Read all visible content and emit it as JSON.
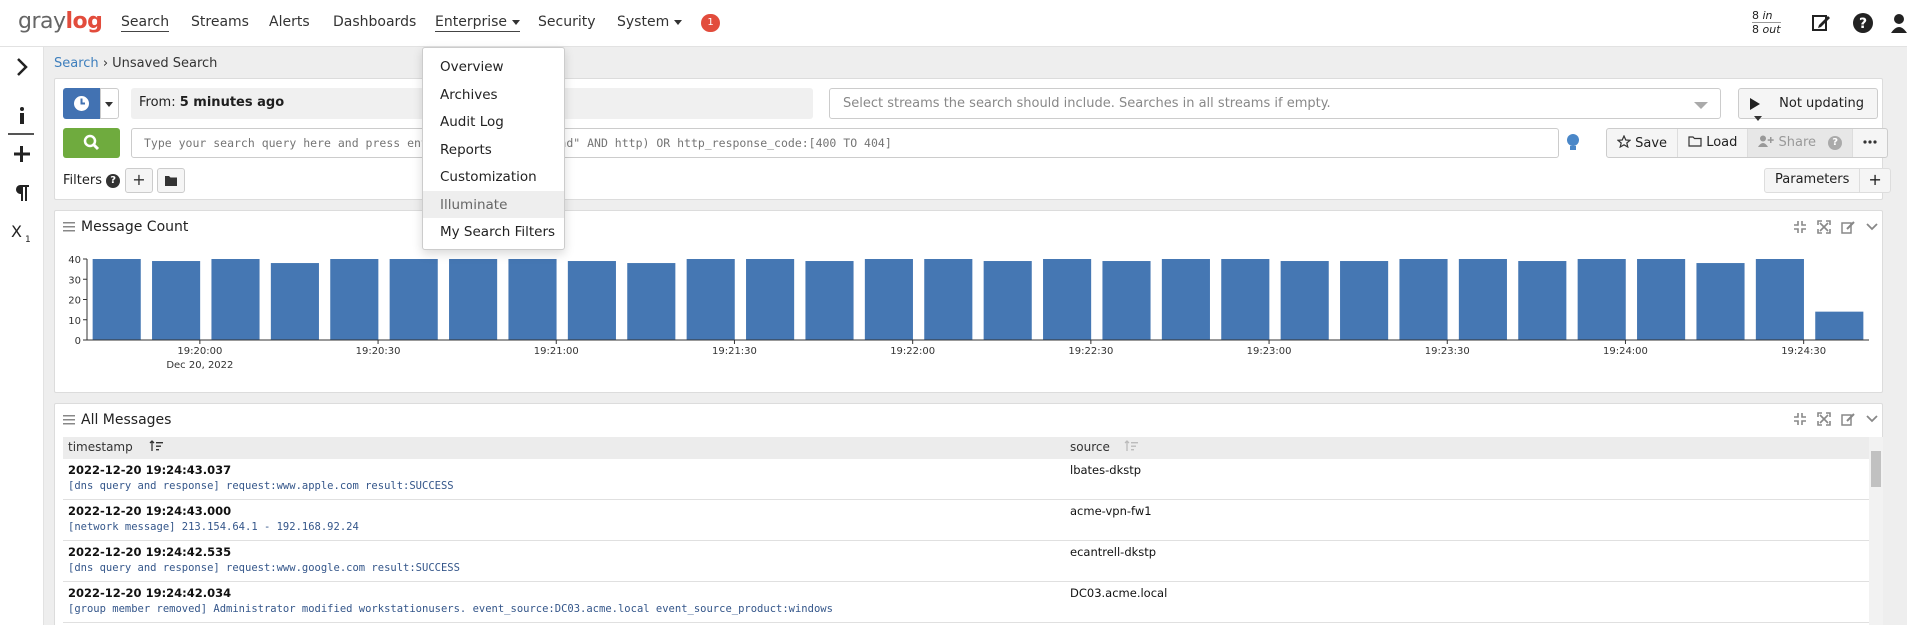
{
  "brand": {
    "logo_part1": "gray",
    "logo_part2": "log",
    "accent": "#e24c3c"
  },
  "nav": {
    "items": [
      {
        "label": "Search",
        "active": true
      },
      {
        "label": "Streams"
      },
      {
        "label": "Alerts"
      },
      {
        "label": "Dashboards"
      },
      {
        "label": "Enterprise",
        "dropdown": true
      },
      {
        "label": "Security"
      },
      {
        "label": "System",
        "dropdown": true
      }
    ],
    "notification_count": "1",
    "throughput_in": "8",
    "throughput_in_label": "in",
    "throughput_out": "8",
    "throughput_out_label": "out"
  },
  "enterprise_menu": {
    "items": [
      "Overview",
      "Archives",
      "Audit Log",
      "Reports",
      "Customization",
      "Illuminate",
      "My Search Filters"
    ],
    "hovered": "Illuminate"
  },
  "breadcrumb": {
    "root": "Search",
    "separator": "›",
    "current": "Unsaved Search"
  },
  "search": {
    "time_range_prefix": "From:",
    "time_range_value": "5 minutes ago",
    "streams_placeholder": "Select streams the search should include. Searches in all streams if empty.",
    "refresh_label": "Not updating",
    "query_placeholder": "Type your search query here and press enter. E.g.: (\"not found\" AND http) OR http_response_code:[400 TO 404]",
    "save_label": "Save",
    "load_label": "Load",
    "share_label": "Share",
    "filters_label": "Filters",
    "parameters_label": "Parameters"
  },
  "message_count_widget": {
    "title": "Message Count"
  },
  "chart_data": {
    "type": "bar",
    "title": "Message Count",
    "xlabel": "",
    "ylabel": "",
    "ylim": [
      0,
      40
    ],
    "yticks": [
      0,
      10,
      20,
      30,
      40
    ],
    "xticks": [
      "19:20:00",
      "19:20:30",
      "19:21:00",
      "19:21:30",
      "19:22:00",
      "19:22:30",
      "19:23:00",
      "19:23:30",
      "19:24:00",
      "19:24:30"
    ],
    "xdate": "Dec 20, 2022",
    "values": [
      40,
      39,
      40,
      38,
      40,
      40,
      40,
      40,
      39,
      38,
      40,
      40,
      39,
      40,
      40,
      39,
      40,
      39,
      40,
      40,
      39,
      39,
      40,
      40,
      39,
      40,
      40,
      38,
      40,
      14
    ],
    "color": "#4577b3"
  },
  "all_messages_widget": {
    "title": "All Messages",
    "columns": [
      "timestamp",
      "source"
    ],
    "rows": [
      {
        "timestamp": "2022-12-20 19:24:43.037",
        "message": "[dns query and response] request:www.apple.com result:SUCCESS",
        "source": "lbates-dkstp"
      },
      {
        "timestamp": "2022-12-20 19:24:43.000",
        "message": "[network message] 213.154.64.1 - 192.168.92.24",
        "source": "acme-vpn-fw1"
      },
      {
        "timestamp": "2022-12-20 19:24:42.535",
        "message": "[dns query and response] request:www.google.com result:SUCCESS",
        "source": "ecantrell-dkstp"
      },
      {
        "timestamp": "2022-12-20 19:24:42.034",
        "message": "[group member removed] Administrator modified workstationusers. event_source:DC03.acme.local event_source_product:windows",
        "source": "DC03.acme.local"
      }
    ]
  }
}
